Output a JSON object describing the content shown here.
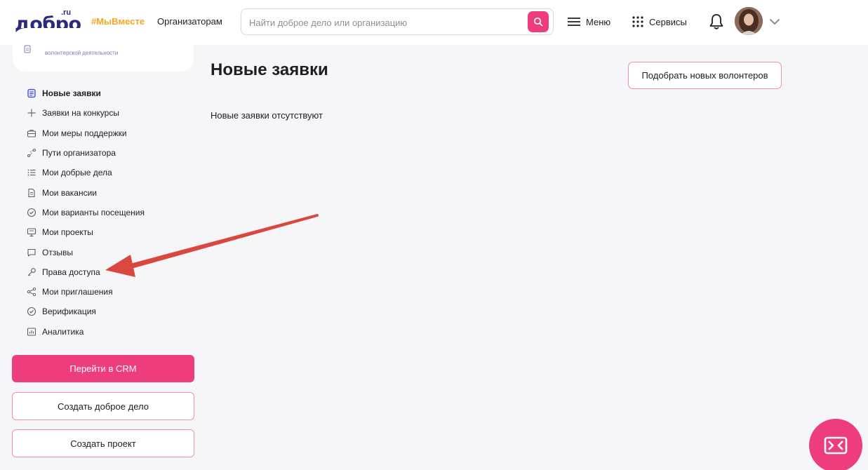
{
  "header": {
    "logo_main": "добро",
    "logo_suffix": ".ru",
    "hashtag": "#МыВместе",
    "organizers_link": "Организаторам",
    "search_placeholder": "Найти доброе дело или организацию",
    "menu_label": "Меню",
    "services_label": "Сервисы"
  },
  "sidebar": {
    "card_text": "волонтерской деятельности",
    "items": [
      {
        "label": "Новые заявки",
        "icon": "document-icon",
        "active": true
      },
      {
        "label": "Заявки на конкурсы",
        "icon": "plus-icon"
      },
      {
        "label": "Мои меры поддержки",
        "icon": "briefcase-icon"
      },
      {
        "label": "Пути организатора",
        "icon": "route-icon"
      },
      {
        "label": "Мои добрые дела",
        "icon": "list-icon"
      },
      {
        "label": "Мои вакансии",
        "icon": "file-icon"
      },
      {
        "label": "Мои варианты посещения",
        "icon": "check-circle-icon"
      },
      {
        "label": "Мои проекты",
        "icon": "presentation-icon"
      },
      {
        "label": "Отзывы",
        "icon": "chat-icon"
      },
      {
        "label": "Права доступа",
        "icon": "key-icon"
      },
      {
        "label": "Мои приглашения",
        "icon": "share-icon"
      },
      {
        "label": "Верификация",
        "icon": "check-circle-icon"
      },
      {
        "label": "Аналитика",
        "icon": "chart-icon"
      }
    ],
    "crm_button": "Перейти в CRM",
    "create_deed_button": "Создать доброе дело",
    "create_project_button": "Создать проект"
  },
  "main": {
    "title": "Новые заявки",
    "pick_volunteers_button": "Подобрать новых волонтеров",
    "empty_message": "Новые заявки отсутствуют"
  },
  "colors": {
    "accent": "#ed3d7c",
    "brand": "#2d2a7e",
    "hashtag": "#f6a623",
    "annotation": "#d9473e"
  }
}
